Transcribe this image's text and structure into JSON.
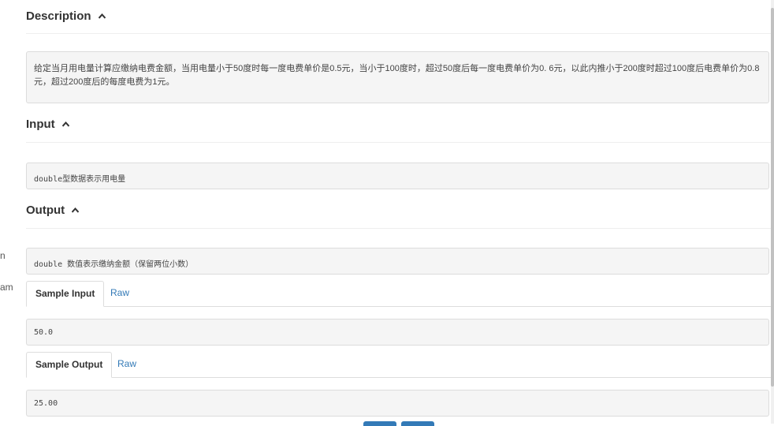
{
  "left_fragments": [
    "n",
    "am"
  ],
  "description": {
    "title": "Description",
    "text": "给定当月用电量计算应缴纳电费金额，当用电量小于50度时每一度电费单价是0.5元，当小于100度时，超过50度后每一度电费单价为0. 6元，以此内推小于200度时超过100度后电费单价为0.8元，超过200度后的每度电费为1元。"
  },
  "input": {
    "title": "Input",
    "text": "double型数据表示用电量"
  },
  "output": {
    "title": "Output",
    "text": "double 数值表示缴纳金额（保留两位小数）"
  },
  "sample_input": {
    "tab_label": "Sample Input",
    "raw_label": "Raw",
    "value": "50.0"
  },
  "sample_output": {
    "tab_label": "Sample Output",
    "raw_label": "Raw",
    "value": "25.00"
  },
  "icons": {
    "collapse": "caret-up-icon"
  }
}
